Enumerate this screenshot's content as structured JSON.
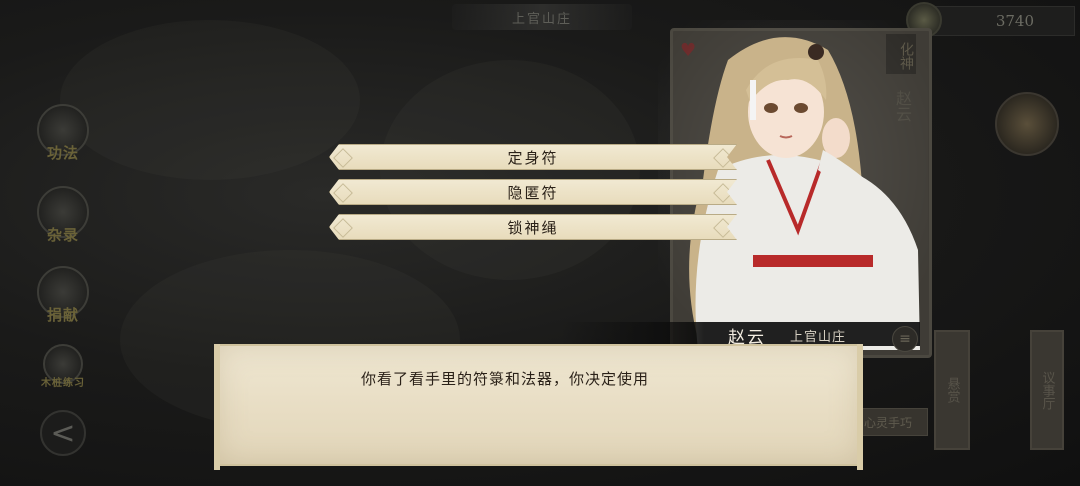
{
  "top_bar": {
    "location": "上官山庄",
    "currency_value": "3740"
  },
  "side_menu": {
    "items": [
      {
        "label": "功法"
      },
      {
        "label": "杂录"
      },
      {
        "label": "捐献"
      },
      {
        "label": "木桩练习"
      }
    ],
    "back_symbol": "<"
  },
  "character_card": {
    "rank": "化神",
    "name": "赵云"
  },
  "right_panel": {
    "tab_left": "悬赏",
    "tab_right": "议事厅",
    "bottom_text": "心灵手巧",
    "menu_symbol": "≡"
  },
  "choices": [
    {
      "label": "定身符"
    },
    {
      "label": "隐匿符"
    },
    {
      "label": "锁神绳"
    }
  ],
  "dialog": {
    "speaker_name": "赵云",
    "speaker_title": "上官山庄",
    "text": "你看了看手里的符箓和法器，你决定使用"
  },
  "colors": {
    "choice_bg": "#f1e9d2",
    "dialog_bg": "#efe7d2",
    "accent_red": "#b82a2a"
  }
}
